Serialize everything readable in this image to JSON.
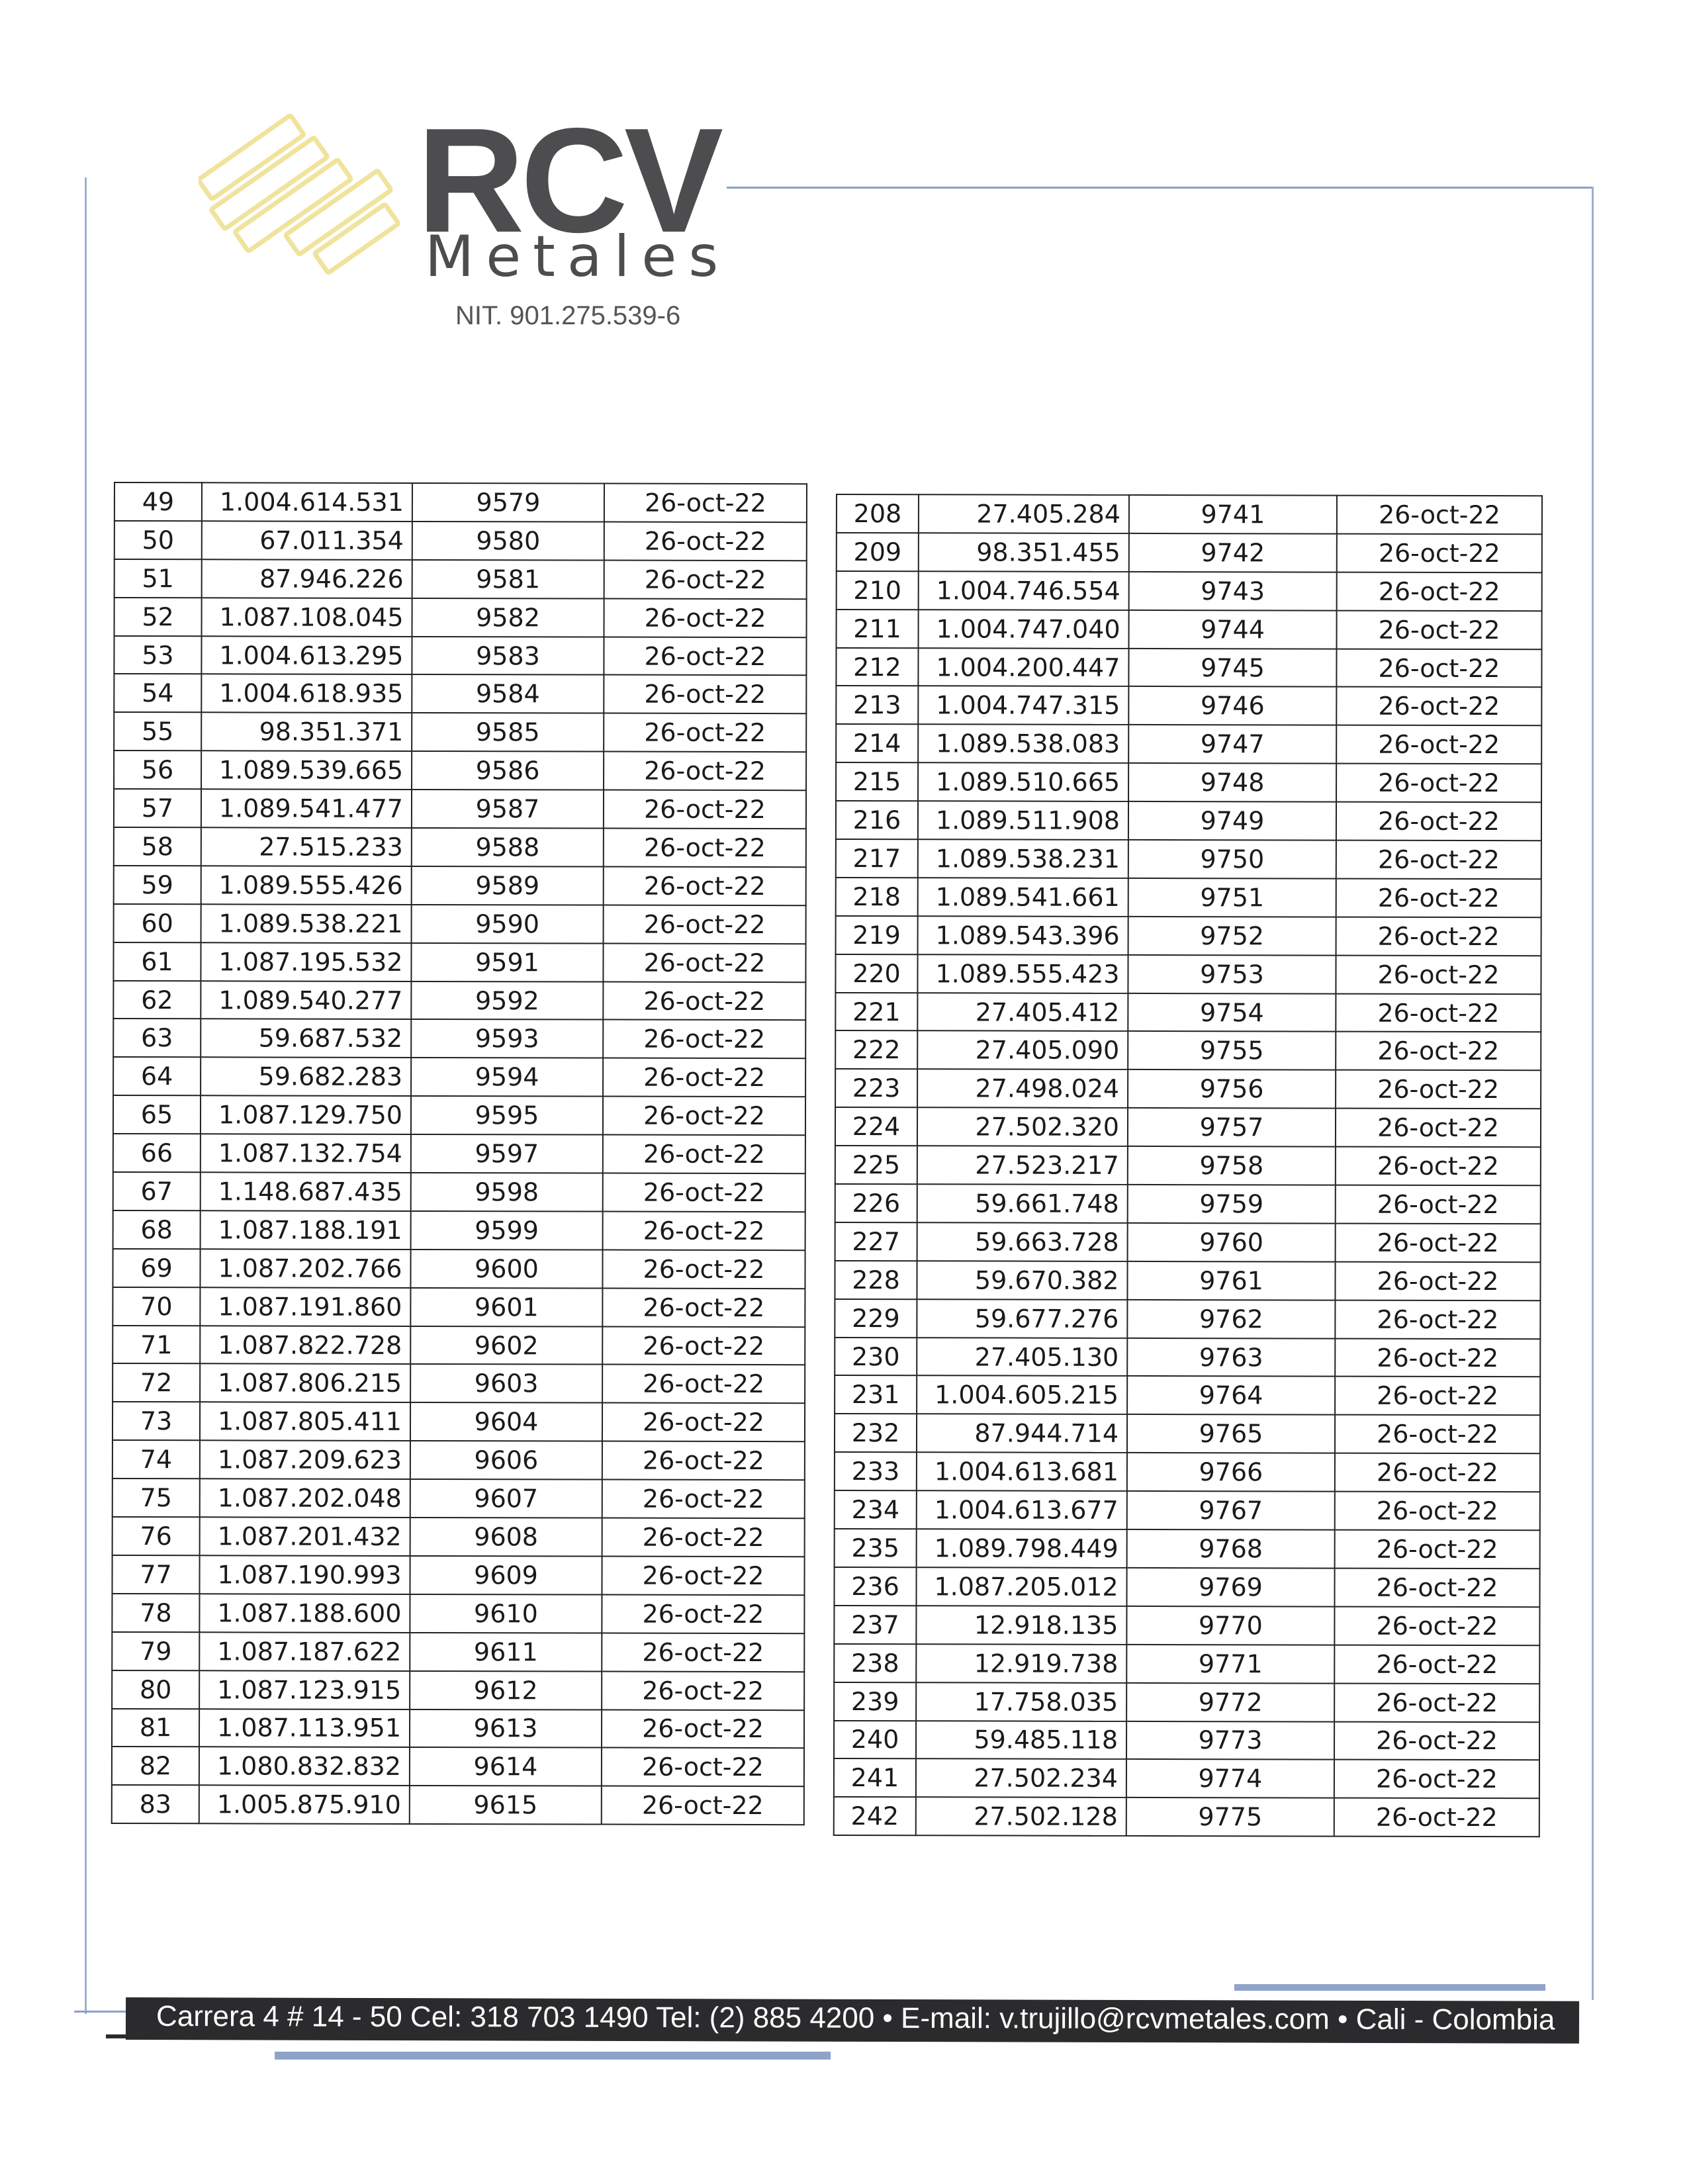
{
  "header": {
    "brand_name": "RCV",
    "brand_sub": "Metales",
    "nit": "NIT. 901.275.539-6",
    "logo_color": "#f2e7a2",
    "brand_color": "#4d4d4f"
  },
  "table_left": {
    "rows": [
      [
        "49",
        "1.004.614.531",
        "9579",
        "26-oct-22"
      ],
      [
        "50",
        "67.011.354",
        "9580",
        "26-oct-22"
      ],
      [
        "51",
        "87.946.226",
        "9581",
        "26-oct-22"
      ],
      [
        "52",
        "1.087.108.045",
        "9582",
        "26-oct-22"
      ],
      [
        "53",
        "1.004.613.295",
        "9583",
        "26-oct-22"
      ],
      [
        "54",
        "1.004.618.935",
        "9584",
        "26-oct-22"
      ],
      [
        "55",
        "98.351.371",
        "9585",
        "26-oct-22"
      ],
      [
        "56",
        "1.089.539.665",
        "9586",
        "26-oct-22"
      ],
      [
        "57",
        "1.089.541.477",
        "9587",
        "26-oct-22"
      ],
      [
        "58",
        "27.515.233",
        "9588",
        "26-oct-22"
      ],
      [
        "59",
        "1.089.555.426",
        "9589",
        "26-oct-22"
      ],
      [
        "60",
        "1.089.538.221",
        "9590",
        "26-oct-22"
      ],
      [
        "61",
        "1.087.195.532",
        "9591",
        "26-oct-22"
      ],
      [
        "62",
        "1.089.540.277",
        "9592",
        "26-oct-22"
      ],
      [
        "63",
        "59.687.532",
        "9593",
        "26-oct-22"
      ],
      [
        "64",
        "59.682.283",
        "9594",
        "26-oct-22"
      ],
      [
        "65",
        "1.087.129.750",
        "9595",
        "26-oct-22"
      ],
      [
        "66",
        "1.087.132.754",
        "9597",
        "26-oct-22"
      ],
      [
        "67",
        "1.148.687.435",
        "9598",
        "26-oct-22"
      ],
      [
        "68",
        "1.087.188.191",
        "9599",
        "26-oct-22"
      ],
      [
        "69",
        "1.087.202.766",
        "9600",
        "26-oct-22"
      ],
      [
        "70",
        "1.087.191.860",
        "9601",
        "26-oct-22"
      ],
      [
        "71",
        "1.087.822.728",
        "9602",
        "26-oct-22"
      ],
      [
        "72",
        "1.087.806.215",
        "9603",
        "26-oct-22"
      ],
      [
        "73",
        "1.087.805.411",
        "9604",
        "26-oct-22"
      ],
      [
        "74",
        "1.087.209.623",
        "9606",
        "26-oct-22"
      ],
      [
        "75",
        "1.087.202.048",
        "9607",
        "26-oct-22"
      ],
      [
        "76",
        "1.087.201.432",
        "9608",
        "26-oct-22"
      ],
      [
        "77",
        "1.087.190.993",
        "9609",
        "26-oct-22"
      ],
      [
        "78",
        "1.087.188.600",
        "9610",
        "26-oct-22"
      ],
      [
        "79",
        "1.087.187.622",
        "9611",
        "26-oct-22"
      ],
      [
        "80",
        "1.087.123.915",
        "9612",
        "26-oct-22"
      ],
      [
        "81",
        "1.087.113.951",
        "9613",
        "26-oct-22"
      ],
      [
        "82",
        "1.080.832.832",
        "9614",
        "26-oct-22"
      ],
      [
        "83",
        "1.005.875.910",
        "9615",
        "26-oct-22"
      ]
    ]
  },
  "table_right": {
    "rows": [
      [
        "208",
        "27.405.284",
        "9741",
        "26-oct-22"
      ],
      [
        "209",
        "98.351.455",
        "9742",
        "26-oct-22"
      ],
      [
        "210",
        "1.004.746.554",
        "9743",
        "26-oct-22"
      ],
      [
        "211",
        "1.004.747.040",
        "9744",
        "26-oct-22"
      ],
      [
        "212",
        "1.004.200.447",
        "9745",
        "26-oct-22"
      ],
      [
        "213",
        "1.004.747.315",
        "9746",
        "26-oct-22"
      ],
      [
        "214",
        "1.089.538.083",
        "9747",
        "26-oct-22"
      ],
      [
        "215",
        "1.089.510.665",
        "9748",
        "26-oct-22"
      ],
      [
        "216",
        "1.089.511.908",
        "9749",
        "26-oct-22"
      ],
      [
        "217",
        "1.089.538.231",
        "9750",
        "26-oct-22"
      ],
      [
        "218",
        "1.089.541.661",
        "9751",
        "26-oct-22"
      ],
      [
        "219",
        "1.089.543.396",
        "9752",
        "26-oct-22"
      ],
      [
        "220",
        "1.089.555.423",
        "9753",
        "26-oct-22"
      ],
      [
        "221",
        "27.405.412",
        "9754",
        "26-oct-22"
      ],
      [
        "222",
        "27.405.090",
        "9755",
        "26-oct-22"
      ],
      [
        "223",
        "27.498.024",
        "9756",
        "26-oct-22"
      ],
      [
        "224",
        "27.502.320",
        "9757",
        "26-oct-22"
      ],
      [
        "225",
        "27.523.217",
        "9758",
        "26-oct-22"
      ],
      [
        "226",
        "59.661.748",
        "9759",
        "26-oct-22"
      ],
      [
        "227",
        "59.663.728",
        "9760",
        "26-oct-22"
      ],
      [
        "228",
        "59.670.382",
        "9761",
        "26-oct-22"
      ],
      [
        "229",
        "59.677.276",
        "9762",
        "26-oct-22"
      ],
      [
        "230",
        "27.405.130",
        "9763",
        "26-oct-22"
      ],
      [
        "231",
        "1.004.605.215",
        "9764",
        "26-oct-22"
      ],
      [
        "232",
        "87.944.714",
        "9765",
        "26-oct-22"
      ],
      [
        "233",
        "1.004.613.681",
        "9766",
        "26-oct-22"
      ],
      [
        "234",
        "1.004.613.677",
        "9767",
        "26-oct-22"
      ],
      [
        "235",
        "1.089.798.449",
        "9768",
        "26-oct-22"
      ],
      [
        "236",
        "1.087.205.012",
        "9769",
        "26-oct-22"
      ],
      [
        "237",
        "12.918.135",
        "9770",
        "26-oct-22"
      ],
      [
        "238",
        "12.919.738",
        "9771",
        "26-oct-22"
      ],
      [
        "239",
        "17.758.035",
        "9772",
        "26-oct-22"
      ],
      [
        "240",
        "59.485.118",
        "9773",
        "26-oct-22"
      ],
      [
        "241",
        "27.502.234",
        "9774",
        "26-oct-22"
      ],
      [
        "242",
        "27.502.128",
        "9775",
        "26-oct-22"
      ]
    ]
  },
  "footer": {
    "contact": "Carrera 4 # 14 - 50 Cel: 318 703 1490 Tel: (2) 885 4200 • E-mail: v.trujillo@rcvmetales.com • Cali - Colombia"
  }
}
